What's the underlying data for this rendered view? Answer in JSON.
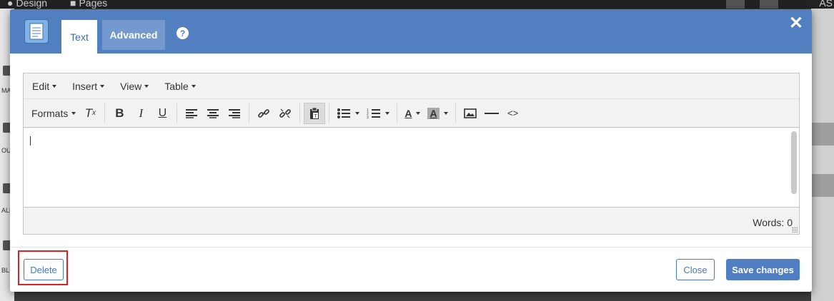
{
  "background": {
    "tabs": [
      "Design",
      "Pages"
    ],
    "left_items": [
      "MA",
      "OUT",
      "ALL",
      "BL"
    ],
    "right_text": "AS"
  },
  "modal": {
    "tabs": [
      {
        "label": "Text",
        "active": true
      },
      {
        "label": "Advanced",
        "active": false
      }
    ],
    "header_color": "#527fbf"
  },
  "editor": {
    "menus": [
      "Edit",
      "Insert",
      "View",
      "Table"
    ],
    "formats_label": "Formats",
    "toolbar_icons": [
      "clear-formatting-icon",
      "bold-icon",
      "italic-icon",
      "underline-icon",
      "align-left-icon",
      "align-center-icon",
      "align-right-icon",
      "link-icon",
      "unlink-icon",
      "paste-text-icon",
      "bullet-list-icon",
      "numbered-list-icon",
      "text-color-icon",
      "background-color-icon",
      "image-icon",
      "horizontal-rule-icon",
      "source-code-icon"
    ],
    "word_count": "Words: 0"
  },
  "footer": {
    "delete_label": "Delete",
    "close_label": "Close",
    "save_label": "Save changes"
  }
}
